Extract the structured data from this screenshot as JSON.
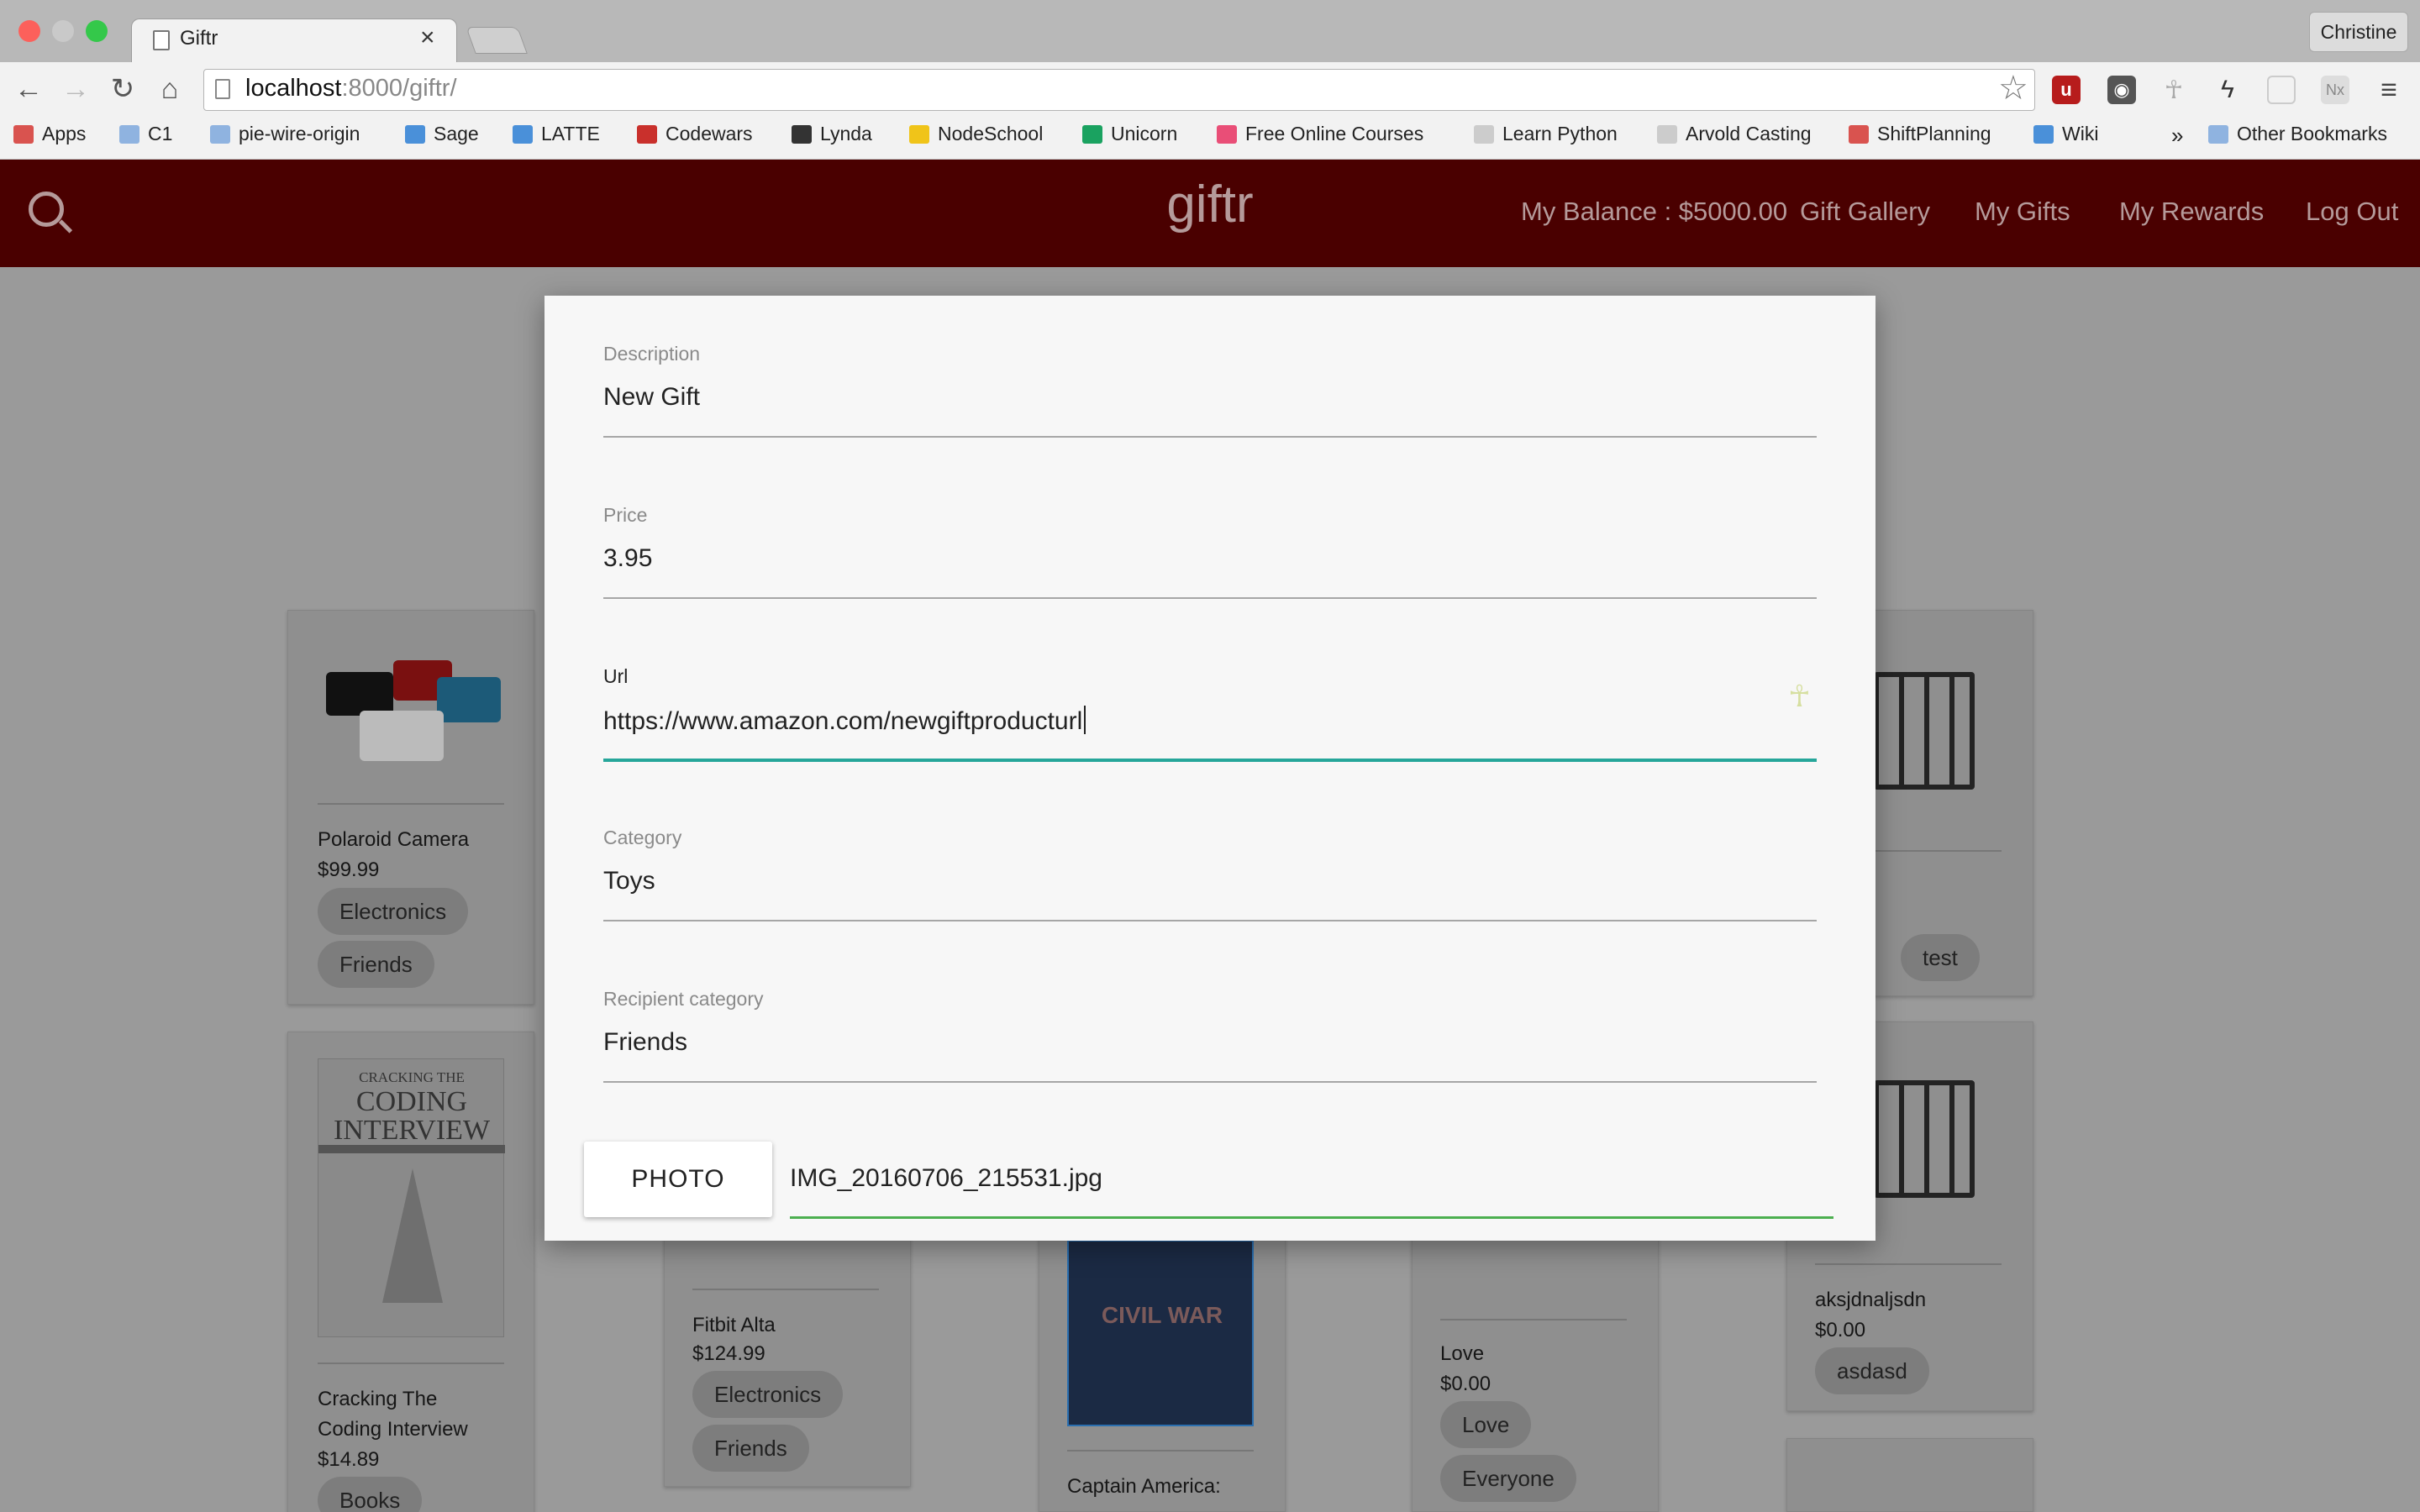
{
  "browser": {
    "tab_title": "Giftr",
    "profile_name": "Christine",
    "url_host": "localhost",
    "url_rest": ":8000/giftr/",
    "bookmarks": [
      {
        "label": "Apps",
        "color": "#d9534f"
      },
      {
        "label": "C1",
        "color": "#8fb3e0"
      },
      {
        "label": "pie-wire-origin",
        "color": "#8fb3e0"
      },
      {
        "label": "Sage",
        "color": "#4a90d9"
      },
      {
        "label": "LATTE",
        "color": "#4a90d9"
      },
      {
        "label": "Codewars",
        "color": "#c9302c"
      },
      {
        "label": "Lynda",
        "color": "#333333"
      },
      {
        "label": "NodeSchool",
        "color": "#f0c419"
      },
      {
        "label": "Unicorn",
        "color": "#1aa260"
      },
      {
        "label": "Free Online Courses",
        "color": "#e94e77"
      },
      {
        "label": "Learn Python",
        "color": "#cccccc"
      },
      {
        "label": "Arvold Casting",
        "color": "#cccccc"
      },
      {
        "label": "ShiftPlanning",
        "color": "#d9534f"
      },
      {
        "label": "Wiki",
        "color": "#4a90d9"
      }
    ],
    "bookmarks_overflow": "»",
    "other_bookmarks": "Other Bookmarks"
  },
  "app": {
    "title": "giftr",
    "balance": "My Balance : $5000.00",
    "nav": [
      "Gift Gallery",
      "My Gifts",
      "My Rewards",
      "Log Out"
    ]
  },
  "form": {
    "description_label": "Description",
    "description_value": "New Gift",
    "price_label": "Price",
    "price_value": "3.95",
    "url_label": "Url",
    "url_value": "https://www.amazon.com/newgiftproducturl",
    "category_label": "Category",
    "category_value": "Toys",
    "recipient_label": "Recipient category",
    "recipient_value": "Friends",
    "photo_button": "PHOTO",
    "photo_filename": "IMG_20160706_215531.jpg"
  },
  "cards": {
    "polaroid": {
      "name": "Polaroid Camera",
      "price": "$99.99",
      "tags": [
        "Electronics",
        "Friends"
      ]
    },
    "cracking": {
      "name_line1": "Cracking The",
      "name_line2": "Coding Interview",
      "price": "$14.89",
      "tags": [
        "Books"
      ],
      "cover_line1": "CRACKING THE",
      "cover_line2": "CODING",
      "cover_line3": "INTERVIEW"
    },
    "fitbit": {
      "name": "Fitbit Alta",
      "price": "$124.99",
      "tags": [
        "Electronics",
        "Friends"
      ]
    },
    "captain": {
      "name": "Captain America:",
      "cover_text": "CIVIL WAR"
    },
    "love": {
      "name": "Love",
      "price": "$0.00",
      "tags": [
        "Love",
        "Everyone"
      ]
    },
    "right_top": {
      "tags": [
        "test"
      ]
    },
    "right_mid": {
      "name": "aksjdnaljsdn",
      "price": "$0.00",
      "tags": [
        "asdasd"
      ]
    }
  },
  "colors": {
    "header_bg": "#4a0000",
    "url_focus_underline": "#26a69a",
    "file_underline": "#4caf50"
  }
}
